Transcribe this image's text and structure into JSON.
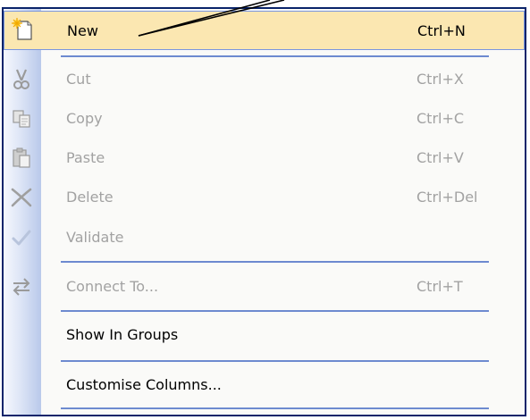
{
  "menu": {
    "items": [
      {
        "label": "New",
        "shortcut": "Ctrl+N",
        "icon": "new-document-icon",
        "state": "highlighted"
      },
      {
        "label": "Cut",
        "shortcut": "Ctrl+X",
        "icon": "scissors-icon",
        "state": "disabled"
      },
      {
        "label": "Copy",
        "shortcut": "Ctrl+C",
        "icon": "copy-icon",
        "state": "disabled"
      },
      {
        "label": "Paste",
        "shortcut": "Ctrl+V",
        "icon": "paste-icon",
        "state": "disabled"
      },
      {
        "label": "Delete",
        "shortcut": "Ctrl+Del",
        "icon": "delete-x-icon",
        "state": "disabled"
      },
      {
        "label": "Validate",
        "shortcut": "",
        "icon": "checkmark-icon",
        "state": "disabled"
      },
      {
        "label": "Connect To...",
        "shortcut": "Ctrl+T",
        "icon": "connect-arrows-icon",
        "state": "disabled"
      },
      {
        "label": "Show In Groups",
        "shortcut": "",
        "icon": "",
        "state": "enabled"
      },
      {
        "label": "Customise Columns...",
        "shortcut": "",
        "icon": "",
        "state": "enabled"
      }
    ]
  },
  "colors": {
    "border": "#0a246a",
    "highlight_bg": "#fbe7b1",
    "separator": "#6d8ad0",
    "disabled_text": "#a2a2a2"
  }
}
